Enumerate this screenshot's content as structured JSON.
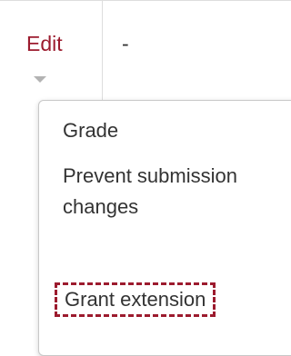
{
  "table": {
    "edit_label": "Edit",
    "cell_value": "-"
  },
  "menu": {
    "items": [
      {
        "label": "Grade"
      },
      {
        "label": "Prevent submission changes"
      },
      {
        "label": "Grant extension"
      }
    ]
  },
  "colors": {
    "accent": "#9c1b2e",
    "text": "#333333",
    "caret": "#b3b3b3"
  },
  "icons": {
    "edit_dropdown": "caret-down-icon"
  }
}
